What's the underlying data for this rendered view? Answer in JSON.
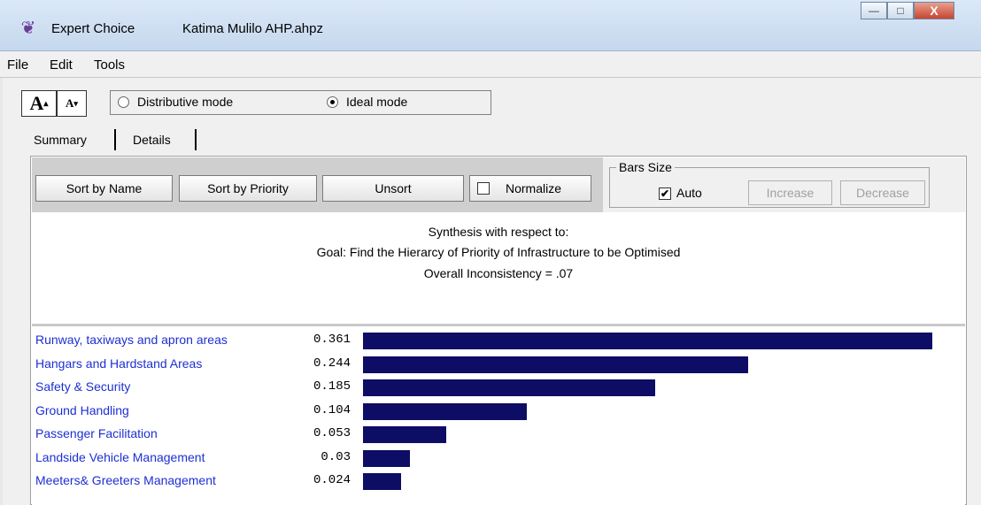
{
  "window": {
    "app_name": "Expert Choice",
    "file_name": "Katima Mulilo AHP.ahpz",
    "minimize_label": "—",
    "maximize_label": "□",
    "close_label": "X"
  },
  "menu": [
    "File",
    "Edit",
    "Tools"
  ],
  "toolbar": {
    "font_increase": "A",
    "font_decrease": "A",
    "modes": [
      {
        "label": "Distributive mode",
        "selected": false
      },
      {
        "label": "Ideal mode",
        "selected": true
      }
    ]
  },
  "tabs": [
    {
      "label": "Summary",
      "active": true
    },
    {
      "label": "Details",
      "active": false
    }
  ],
  "buttons": {
    "sort_name": "Sort by Name",
    "sort_priority": "Sort by Priority",
    "unsort": "Unsort",
    "normalize": "Normalize",
    "normalize_checked": false
  },
  "bars_size": {
    "legend": "Bars Size",
    "auto_label": "Auto",
    "auto_checked": true,
    "increase": "Increase",
    "decrease": "Decrease"
  },
  "synthesis": {
    "line1": "Synthesis with respect to:",
    "line2": "Goal: Find the Hierarcy of Priority of Infrastructure to be Optimised",
    "line3": "Overall Inconsistency = .07"
  },
  "chart_data": {
    "type": "bar",
    "categories": [
      "Runway, taxiways and apron areas",
      "Hangars and Hardstand Areas",
      "Safety & Security",
      "Ground Handling",
      "Passenger Facilitation",
      "Landside Vehicle Management",
      "Meeters& Greeters Management"
    ],
    "value_labels": [
      "0.361",
      "0.244",
      "0.185",
      "0.104",
      "0.053",
      "0.03",
      "0.024"
    ],
    "values": [
      0.361,
      0.244,
      0.185,
      0.104,
      0.053,
      0.03,
      0.024
    ],
    "bar_color": "#0d0d65"
  }
}
